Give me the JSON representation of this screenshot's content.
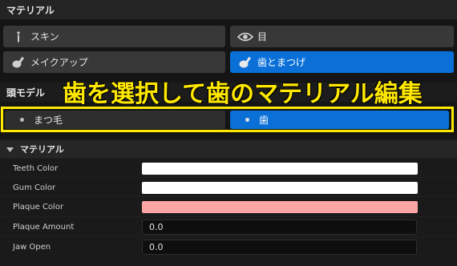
{
  "material_section": {
    "title": "マテリアル"
  },
  "material_buttons": [
    {
      "label": "スキン",
      "icon": "figure-icon"
    },
    {
      "label": "目",
      "icon": "eye-icon"
    },
    {
      "label": "メイクアップ",
      "icon": "brush-icon"
    },
    {
      "label": "歯とまつげ",
      "icon": "brush-icon",
      "selected": true
    }
  ],
  "head_model": {
    "title": "頭モデル"
  },
  "overlay": {
    "text": "歯を選択して歯のマテリアル編集"
  },
  "part_buttons": [
    {
      "label": "まつ毛"
    },
    {
      "label": "歯",
      "selected": true
    }
  ],
  "details": {
    "title": "マテリアル",
    "properties": [
      {
        "label": "Teeth Color",
        "color": "#ffffff"
      },
      {
        "label": "Gum Color",
        "color": "#ffffff"
      },
      {
        "label": "Plaque Color",
        "color": "#fda6a6"
      },
      {
        "label": "Plaque Amount",
        "value": "0.0"
      },
      {
        "label": "Jaw Open",
        "value": "0.0"
      }
    ]
  },
  "colors": {
    "accent": "#0a70d8",
    "highlight": "#ffe800"
  }
}
